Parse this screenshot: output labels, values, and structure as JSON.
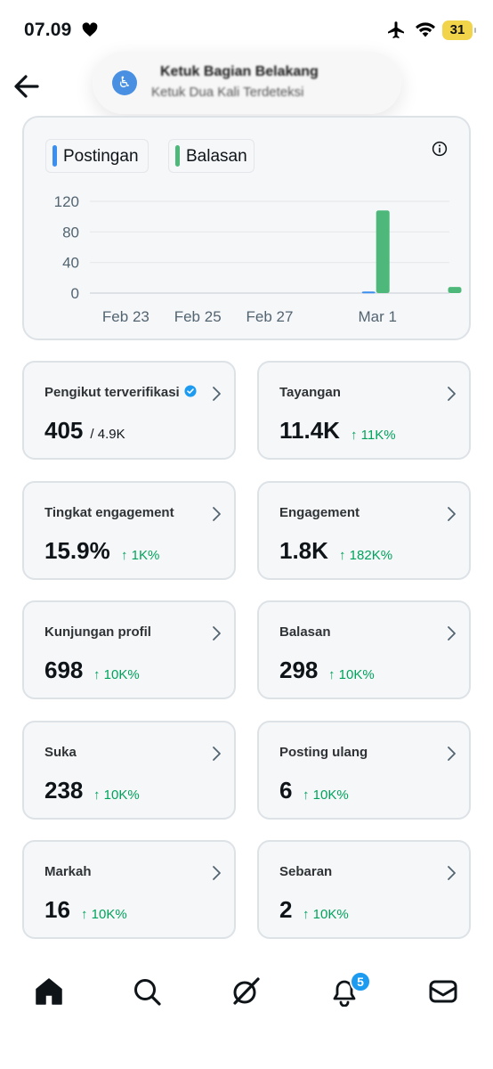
{
  "status_bar": {
    "time": "07.09",
    "battery": "31"
  },
  "toast": {
    "title": "Ketuk Bagian Belakang",
    "subtitle": "Ketuk Dua Kali Terdeteksi"
  },
  "chart_data": {
    "type": "bar",
    "series": [
      {
        "name": "Postingan",
        "color": "#3b8ff0",
        "values": [
          0,
          0,
          0,
          0,
          0,
          0,
          0,
          0,
          2,
          0,
          0
        ]
      },
      {
        "name": "Balasan",
        "color": "#4db87a",
        "values": [
          0,
          0,
          0,
          0,
          0,
          0,
          0,
          0,
          108,
          0,
          8
        ]
      }
    ],
    "x": [
      "Feb 22",
      "Feb 23",
      "Feb 24",
      "Feb 25",
      "Feb 26",
      "Feb 27",
      "Feb 28",
      "Feb 29",
      "Mar 1",
      "Mar 2",
      "Mar 3"
    ],
    "xticks": [
      "Feb 23",
      "Feb 25",
      "Feb 27",
      "Mar 1"
    ],
    "yticks": [
      "0",
      "40",
      "80",
      "120"
    ],
    "ylim": [
      0,
      120
    ]
  },
  "stats": [
    {
      "label": "Pengikut terverifikasi",
      "value": "405",
      "extra": "/ 4.9K",
      "change": ""
    },
    {
      "label": "Tayangan",
      "value": "11.4K",
      "extra": "",
      "change": "↑ 11K%"
    },
    {
      "label": "Tingkat engagement",
      "value": "15.9%",
      "extra": "",
      "change": "↑ 1K%"
    },
    {
      "label": "Engagement",
      "value": "1.8K",
      "extra": "",
      "change": "↑ 182K%"
    },
    {
      "label": "Kunjungan profil",
      "value": "698",
      "extra": "",
      "change": "↑ 10K%"
    },
    {
      "label": "Balasan",
      "value": "298",
      "extra": "",
      "change": "↑ 10K%"
    },
    {
      "label": "Suka",
      "value": "238",
      "extra": "",
      "change": "↑ 10K%"
    },
    {
      "label": "Posting ulang",
      "value": "6",
      "extra": "",
      "change": "↑ 10K%"
    },
    {
      "label": "Markah",
      "value": "16",
      "extra": "",
      "change": "↑ 10K%"
    },
    {
      "label": "Sebaran",
      "value": "2",
      "extra": "",
      "change": "↑ 10K%"
    }
  ],
  "nav": {
    "items": [
      "home-icon",
      "search-icon",
      "grok-icon",
      "bell-icon",
      "mail-icon"
    ],
    "notifications_badge": "5"
  },
  "colors": {
    "accent": "#1d9bf0",
    "positive": "#00a35c",
    "postingan": "#3b8ff0",
    "balasan": "#4db87a"
  }
}
